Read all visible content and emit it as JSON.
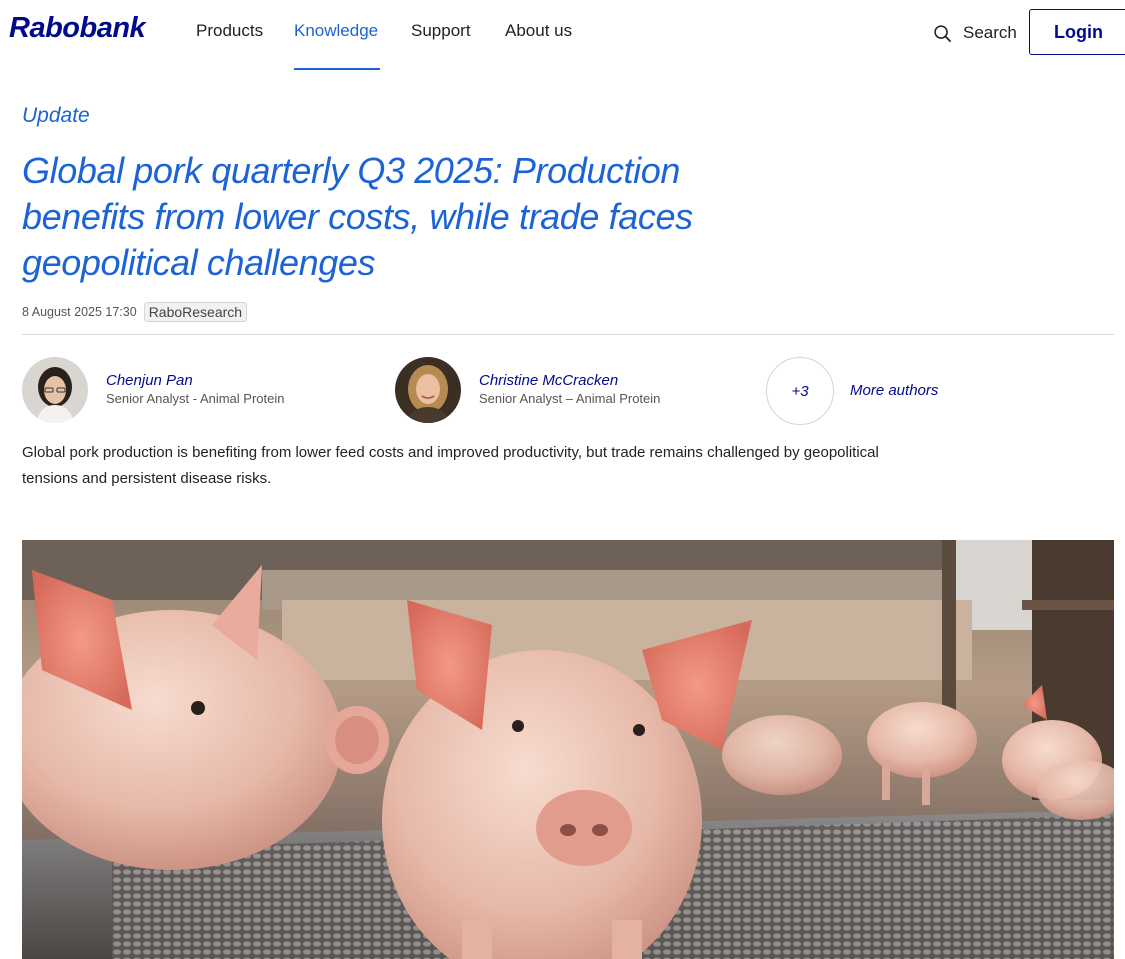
{
  "header": {
    "logo": "Rabobank",
    "nav": [
      {
        "label": "Products"
      },
      {
        "label": "Knowledge"
      },
      {
        "label": "Support"
      },
      {
        "label": "About us"
      }
    ],
    "search_label": "Search",
    "login_label": "Login"
  },
  "article": {
    "category": "Update",
    "title": "Global pork quarterly Q3 2025: Production benefits from lower costs, while trade faces geopolitical challenges",
    "date": "8 August 2025 17:30",
    "tag": "RaboResearch",
    "authors": [
      {
        "name": "Chenjun Pan",
        "role": "Senior Analyst - Animal Protein"
      },
      {
        "name": "Christine McCracken",
        "role": "Senior Analyst – Animal Protein"
      }
    ],
    "more_count": "+3",
    "more_label": "More authors",
    "intro": "Global pork production is benefiting from lower feed costs and improved productivity, but trade remains challenged by geopolitical tensions and persistent disease risks."
  },
  "colors": {
    "brand_navy": "#000b8c",
    "link_blue": "#1b63d6"
  }
}
